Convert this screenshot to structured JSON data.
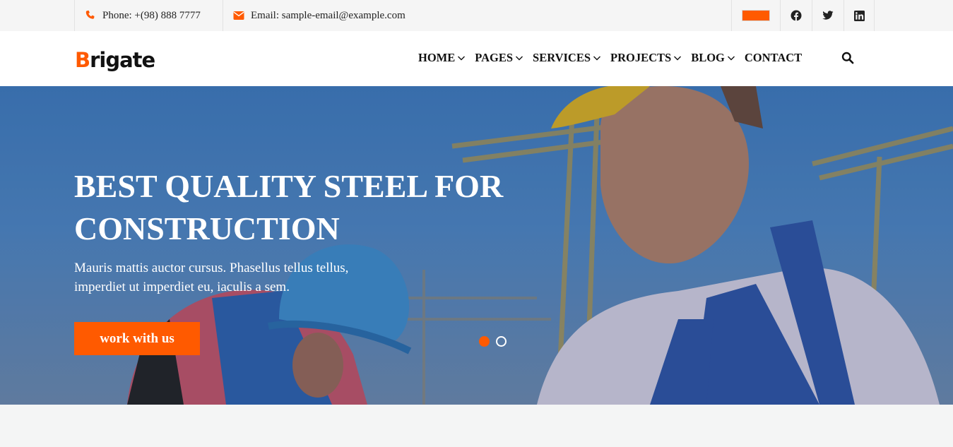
{
  "topbar": {
    "phone": "Phone: +(98) 888 7777",
    "email": "Email: sample-email@example.com",
    "icons": [
      "phone-icon",
      "envelope-icon",
      "language-flag",
      "facebook-icon",
      "twitter-icon",
      "linkedin-icon"
    ]
  },
  "header": {
    "logo_accent": "B",
    "logo_rest": "rigate",
    "nav": [
      {
        "label": "HOME",
        "dropdown": true
      },
      {
        "label": "PAGES",
        "dropdown": true
      },
      {
        "label": "SERVICES",
        "dropdown": true
      },
      {
        "label": "PROJECTS",
        "dropdown": true
      },
      {
        "label": "BLOG",
        "dropdown": true
      },
      {
        "label": "CONTACT",
        "dropdown": false
      }
    ]
  },
  "hero": {
    "title": "BEST QUALITY STEEL FOR CONSTRUCTION",
    "subtitle": "Mauris mattis auctor cursus. Phasellus tellus tellus, imperdiet ut imperdiet eu, iaculis a sem.",
    "button": "work with us",
    "slides": 2,
    "active_slide": 1
  },
  "colors": {
    "accent": "#ff5a00",
    "topbar_bg": "#f5f5f5",
    "text": "#111111"
  }
}
